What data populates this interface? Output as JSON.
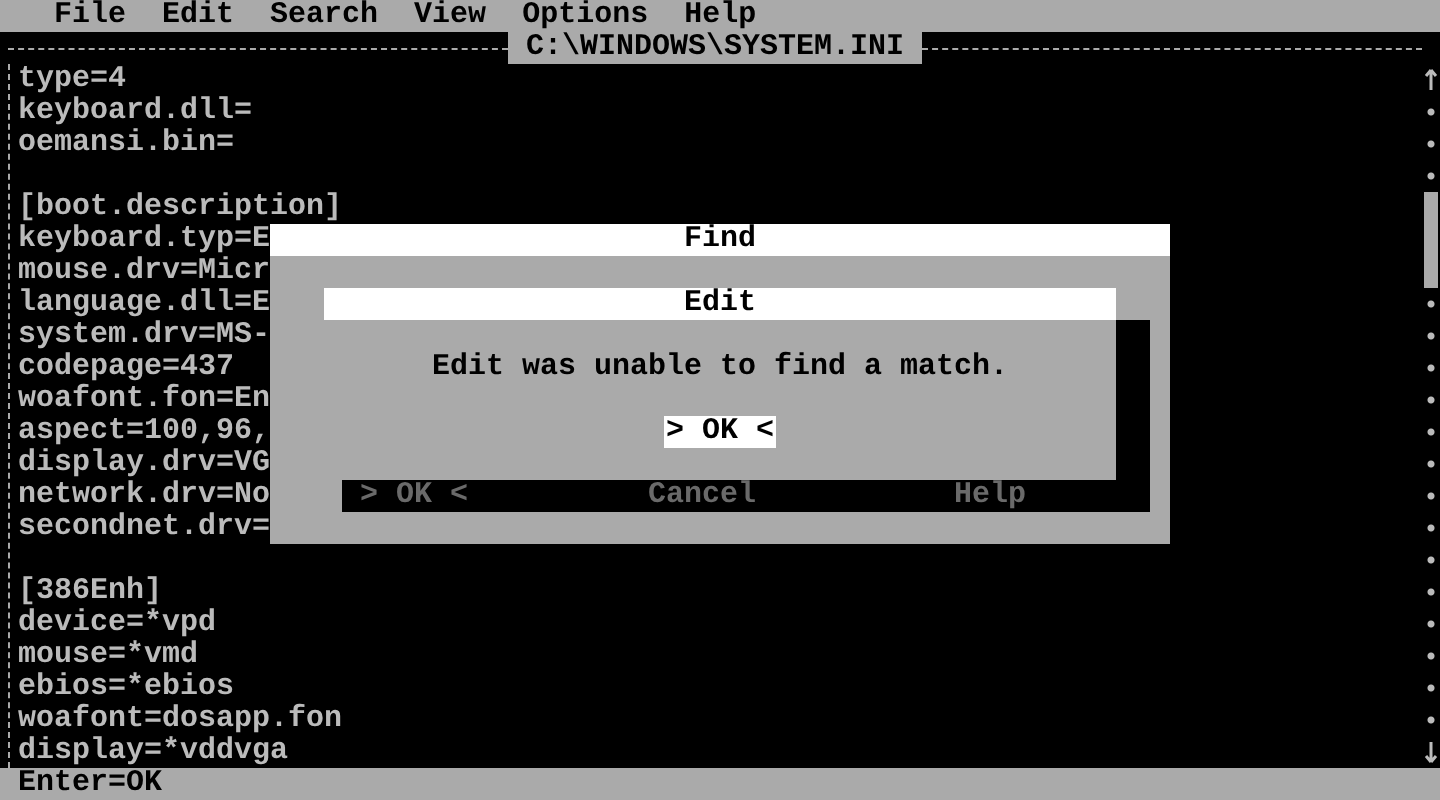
{
  "menu": [
    "File",
    "Edit",
    "Search",
    "View",
    "Options",
    "Help"
  ],
  "file_title": "C:\\WINDOWS\\SYSTEM.INI",
  "lines": [
    {
      "kind": "text",
      "text": "type=4"
    },
    {
      "kind": "text",
      "text": "keyboard.dll="
    },
    {
      "kind": "text",
      "text": "oemansi.bin="
    },
    {
      "kind": "blank"
    },
    {
      "kind": "text",
      "text": "[boot.description]"
    },
    {
      "kind": "text",
      "text": "keyboard.typ=E"
    },
    {
      "kind": "text",
      "text": "mouse.drv=Micr"
    },
    {
      "kind": "text",
      "text": "language.dll=E"
    },
    {
      "kind": "text",
      "text": "system.drv=MS-"
    },
    {
      "kind": "text",
      "text": "codepage=437"
    },
    {
      "kind": "text",
      "text": "woafont.fon=En"
    },
    {
      "kind": "text",
      "text": "aspect=100,96,"
    },
    {
      "kind": "text",
      "text": "display.drv=VG"
    },
    {
      "kind": "text",
      "text": "network.drv=No"
    },
    {
      "kind": "text",
      "text": "secondnet.drv="
    },
    {
      "kind": "blank"
    },
    {
      "kind": "text",
      "text": "[386Enh]"
    },
    {
      "kind": "text",
      "text": "device=*vpd"
    },
    {
      "kind": "text",
      "text": "mouse=*vmd"
    },
    {
      "kind": "text",
      "text": "ebios=*ebios"
    },
    {
      "kind": "text",
      "text": "woafont=dosapp.fon"
    },
    {
      "kind": "text",
      "text": "display=*vddvga"
    }
  ],
  "find_dialog": {
    "title": "Find",
    "buttons": [
      {
        "label": "> OK <",
        "disabled": true
      },
      {
        "label": "Cancel",
        "disabled": true
      },
      {
        "label": "Help",
        "disabled": true
      }
    ]
  },
  "alert": {
    "title": "Edit",
    "message": "Edit was unable to find a match.",
    "button": "> OK <"
  },
  "status_bar": "Enter=OK"
}
